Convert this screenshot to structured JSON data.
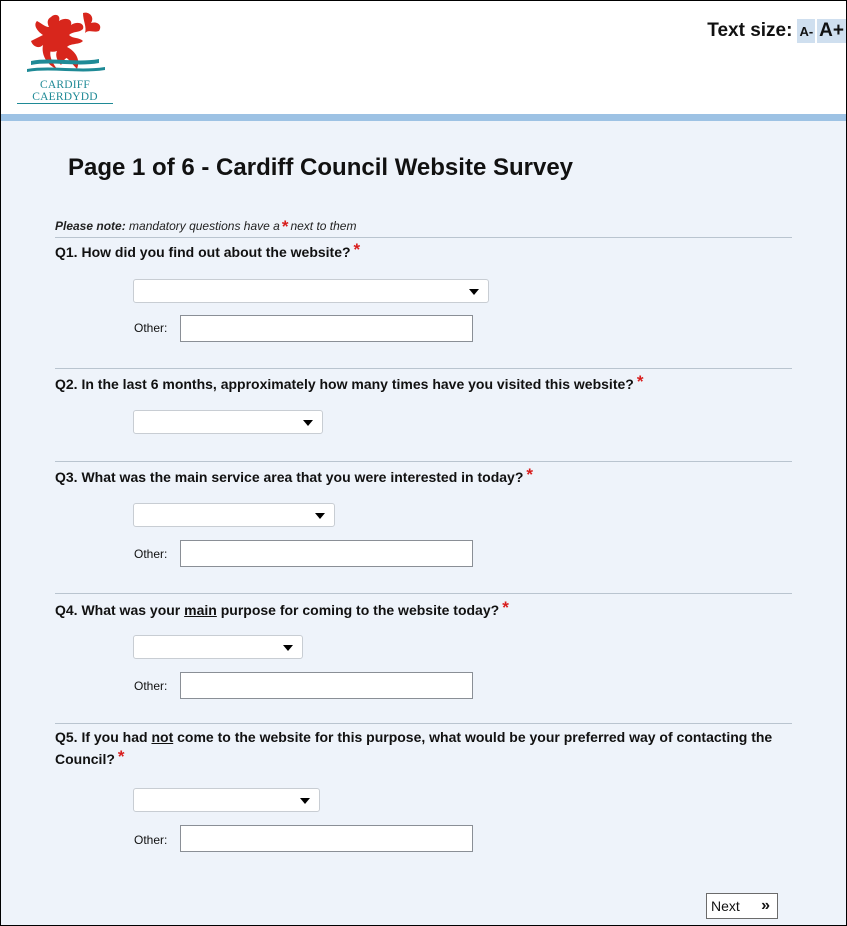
{
  "header": {
    "logo_text_en": "CARDIFF",
    "logo_text_cy": "CAERDYDD",
    "text_size_label": "Text size:",
    "text_size_decrease": "A-",
    "text_size_increase": "A+"
  },
  "page": {
    "title": "Page 1 of 6 - Cardiff Council Website Survey",
    "note_prefix": "Please note:",
    "note_middle": "mandatory questions have a",
    "note_suffix": "next to them",
    "required_marker": "*"
  },
  "questions": [
    {
      "text": "Q1. How did you find out about the website?",
      "selected": "",
      "other_label": "Other:",
      "other_value": ""
    },
    {
      "text": "Q2. In the last 6 months, approximately how many times have you visited this website?",
      "selected": ""
    },
    {
      "text": "Q3. What was the main service area that you were interested in today?",
      "selected": "",
      "other_label": "Other:",
      "other_value": ""
    },
    {
      "text_before": "Q4. What was your",
      "text_underlined": "main",
      "text_after": "purpose for coming to the website today?",
      "selected": "",
      "other_label": "Other:",
      "other_value": ""
    },
    {
      "text_before": "Q5. If you had",
      "text_underlined": "not",
      "text_after": "come to the website for this purpose, what would be your preferred way of contacting the Council?",
      "selected": "",
      "other_label": "Other:",
      "other_value": ""
    }
  ],
  "footer": {
    "next_label": "Next",
    "next_chevron": "»"
  },
  "colors": {
    "page_background": "#eef3fa",
    "header_rule": "#9dc2e4",
    "required_star": "#d81c1c",
    "logo_red": "#d8261c",
    "logo_teal": "#1f8a96"
  }
}
